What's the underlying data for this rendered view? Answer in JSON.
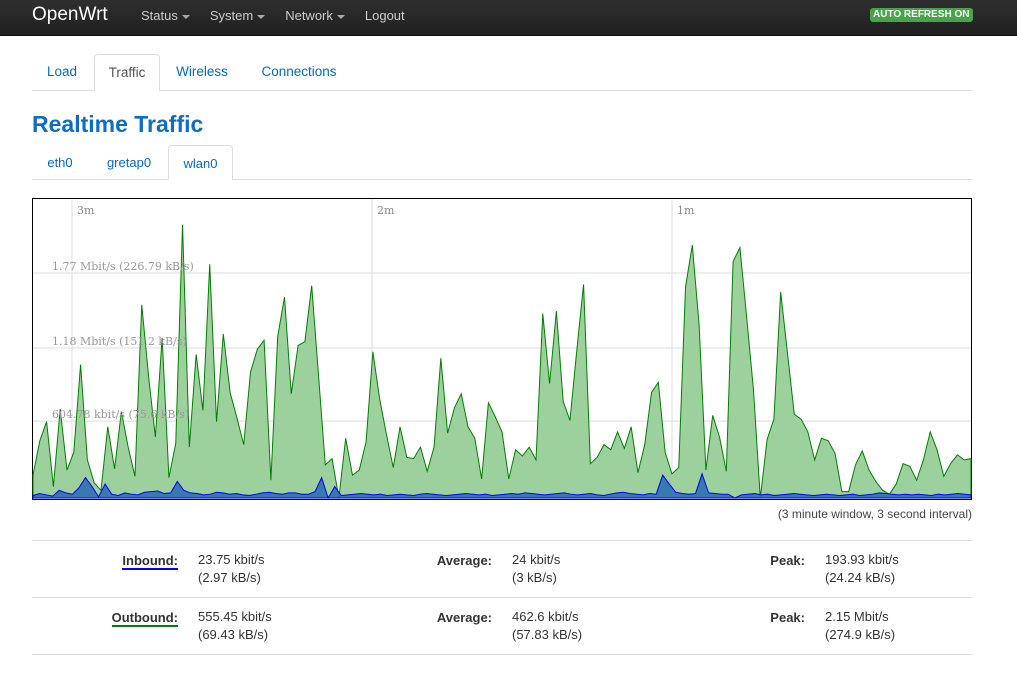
{
  "navbar": {
    "brand": "OpenWrt",
    "items": [
      {
        "label": "Status",
        "dropdown": true
      },
      {
        "label": "System",
        "dropdown": true
      },
      {
        "label": "Network",
        "dropdown": true
      },
      {
        "label": "Logout",
        "dropdown": false
      }
    ],
    "auto_refresh": "AUTO REFRESH ON"
  },
  "tabs": [
    {
      "label": "Load",
      "active": false
    },
    {
      "label": "Traffic",
      "active": true
    },
    {
      "label": "Wireless",
      "active": false
    },
    {
      "label": "Connections",
      "active": false
    }
  ],
  "page_title": "Realtime Traffic",
  "interfaces": [
    {
      "label": "eth0",
      "active": false
    },
    {
      "label": "gretap0",
      "active": false
    },
    {
      "label": "wlan0",
      "active": true
    }
  ],
  "colors": {
    "inbound_line": "#0000ff",
    "inbound_fill": "#2d6fb3",
    "outbound_line": "#008000",
    "outbound_fill": "#97cd97",
    "title": "#0e6dc6",
    "badge": "#46a546"
  },
  "chart_data": {
    "type": "area",
    "time_labels": [
      "3m",
      "2m",
      "1m"
    ],
    "y_labels": [
      "1.77 Mbit/s (226.79 kB/s)",
      "1.18 Mbit/s (151.2 kB/s)",
      "604.78 kbit/s (75.6 kB/s)"
    ],
    "y_label_values_kbit": [
      1770,
      1180,
      604.78
    ],
    "ylim_kbit": [
      0,
      2360
    ],
    "window_seconds": 180,
    "interval_seconds": 3,
    "series": [
      {
        "name": "Outbound",
        "values_kbit": [
          180,
          450,
          600,
          90,
          700,
          220,
          360,
          1050,
          300,
          120,
          60,
          560,
          230,
          680,
          400,
          170,
          1520,
          960,
          480,
          1260,
          160,
          430,
          2150,
          400,
          1130,
          690,
          1840,
          600,
          1290,
          830,
          630,
          420,
          990,
          1170,
          1240,
          140,
          1270,
          1580,
          820,
          1200,
          1230,
          1670,
          970,
          260,
          310,
          0,
          470,
          180,
          220,
          440,
          1150,
          780,
          500,
          240,
          560,
          320,
          310,
          400,
          210,
          400,
          1100,
          510,
          710,
          820,
          560,
          470,
          150,
          750,
          640,
          520,
          150,
          380,
          330,
          400,
          300,
          1450,
          900,
          1470,
          760,
          610,
          1160,
          1680,
          270,
          320,
          420,
          380,
          520,
          390,
          560,
          200,
          420,
          830,
          910,
          360,
          190,
          240,
          1660,
          1990,
          1360,
          220,
          650,
          480,
          210,
          1860,
          1970,
          1420,
          850,
          0,
          460,
          620,
          1620,
          1140,
          660,
          620,
          520,
          300,
          470,
          450,
          350,
          50,
          50,
          260,
          370,
          220,
          130,
          60,
          30,
          110,
          270,
          250,
          140,
          300,
          520,
          380,
          170,
          270,
          340,
          300,
          310
        ],
        "peak": "2.15 Mbit/s",
        "average": "462.6 kbit/s",
        "current": "555.45 kbit/s"
      },
      {
        "name": "Inbound",
        "values_kbit": [
          20,
          35,
          25,
          15,
          60,
          40,
          30,
          80,
          160,
          90,
          10,
          110,
          30,
          20,
          40,
          30,
          25,
          45,
          50,
          55,
          35,
          40,
          130,
          60,
          40,
          35,
          25,
          30,
          45,
          40,
          30,
          35,
          25,
          20,
          30,
          40,
          45,
          35,
          30,
          40,
          40,
          30,
          30,
          50,
          160,
          0,
          90,
          20,
          25,
          30,
          35,
          30,
          25,
          30,
          20,
          25,
          30,
          25,
          20,
          30,
          35,
          30,
          25,
          20,
          25,
          30,
          35,
          30,
          25,
          30,
          20,
          25,
          30,
          35,
          30,
          40,
          35,
          30,
          25,
          30,
          35,
          40,
          30,
          25,
          30,
          35,
          25,
          20,
          30,
          40,
          45,
          35,
          30,
          25,
          35,
          30,
          180,
          110,
          45,
          35,
          30,
          35,
          190,
          40,
          35,
          30,
          30,
          0,
          25,
          30,
          35,
          25,
          30,
          20,
          25,
          30,
          35,
          30,
          25,
          20,
          25,
          30,
          25,
          20,
          25,
          30,
          20,
          25,
          30,
          40,
          35,
          30,
          25,
          30,
          25,
          30,
          25,
          20,
          30,
          25,
          30,
          35,
          30,
          25
        ],
        "peak": "193.93 kbit/s",
        "average": "24 kbit/s",
        "current": "23.75 kbit/s"
      }
    ]
  },
  "window_note": "(3 minute window, 3 second interval)",
  "stats": {
    "inbound": {
      "label": "Inbound:",
      "current": "23.75 kbit/s",
      "current_kb": "(2.97 kB/s)",
      "avg_label": "Average:",
      "avg": "24 kbit/s",
      "avg_kb": "(3 kB/s)",
      "peak_label": "Peak:",
      "peak": "193.93 kbit/s",
      "peak_kb": "(24.24 kB/s)"
    },
    "outbound": {
      "label": "Outbound:",
      "current": "555.45 kbit/s",
      "current_kb": "(69.43 kB/s)",
      "avg_label": "Average:",
      "avg": "462.6 kbit/s",
      "avg_kb": "(57.83 kB/s)",
      "peak_label": "Peak:",
      "peak": "2.15 Mbit/s",
      "peak_kb": "(274.9 kB/s)"
    }
  }
}
